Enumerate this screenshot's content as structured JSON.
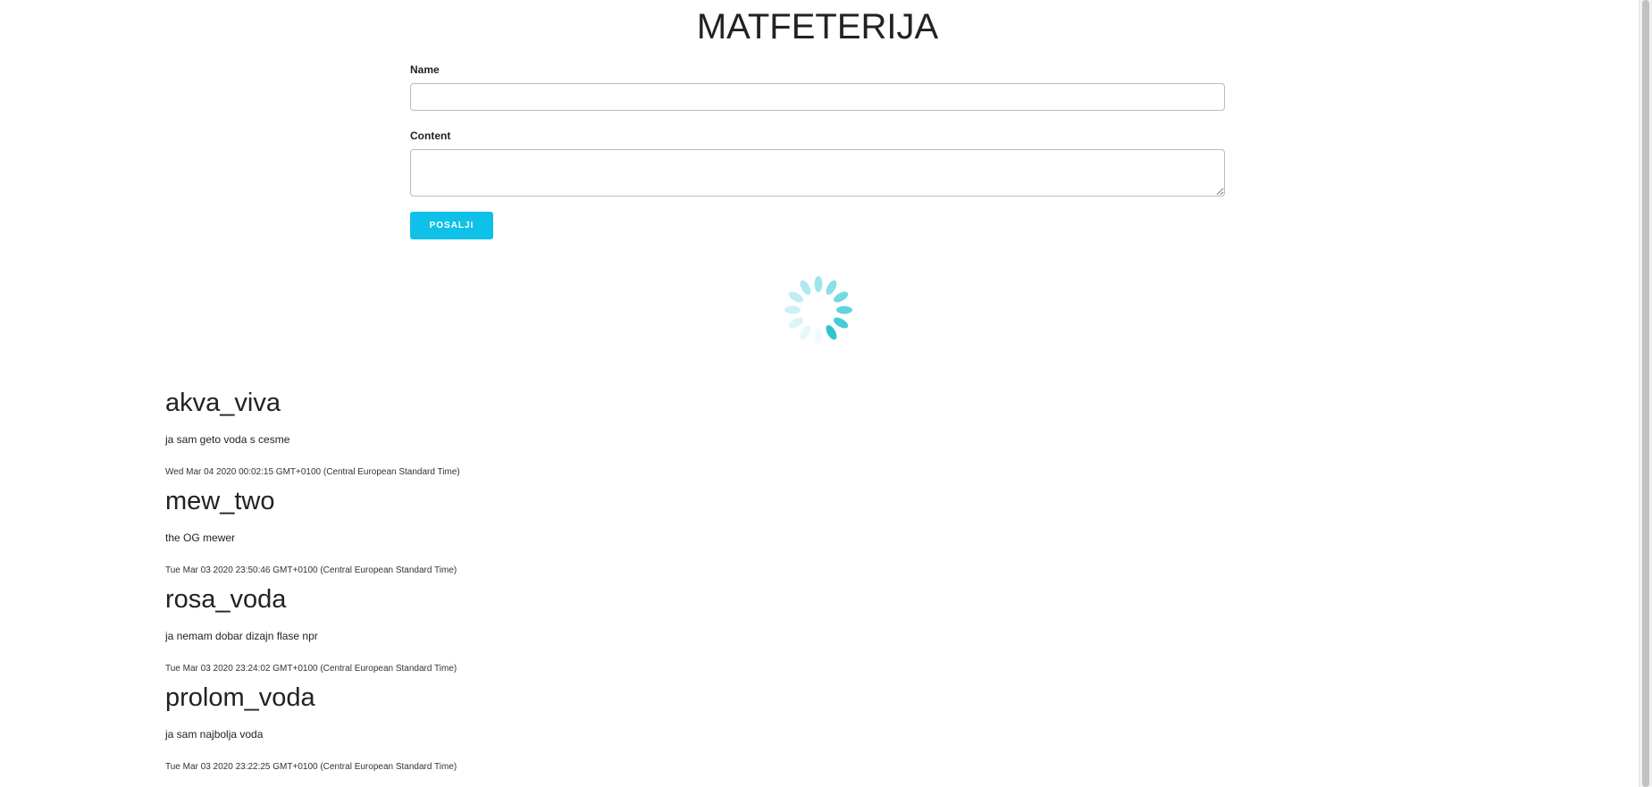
{
  "app": {
    "title": "MATFETERIJA"
  },
  "form": {
    "name_label": "Name",
    "name_value": "",
    "content_label": "Content",
    "content_value": "",
    "submit_label": "POSALJI",
    "accent_color": "#0fc1e8"
  },
  "loader": {
    "icon": "loading-spinner-icon",
    "color": "#2ec5cf"
  },
  "posts": [
    {
      "author": "akva_viva",
      "content": "ja sam geto voda s cesme",
      "date": "Wed Mar 04 2020 00:02:15 GMT+0100 (Central European Standard Time)"
    },
    {
      "author": "mew_two",
      "content": "the OG mewer",
      "date": "Tue Mar 03 2020 23:50:46 GMT+0100 (Central European Standard Time)"
    },
    {
      "author": "rosa_voda",
      "content": "ja nemam dobar dizajn flase npr",
      "date": "Tue Mar 03 2020 23:24:02 GMT+0100 (Central European Standard Time)"
    },
    {
      "author": "prolom_voda",
      "content": "ja sam najbolja voda",
      "date": "Tue Mar 03 2020 23:22:25 GMT+0100 (Central European Standard Time)"
    }
  ]
}
